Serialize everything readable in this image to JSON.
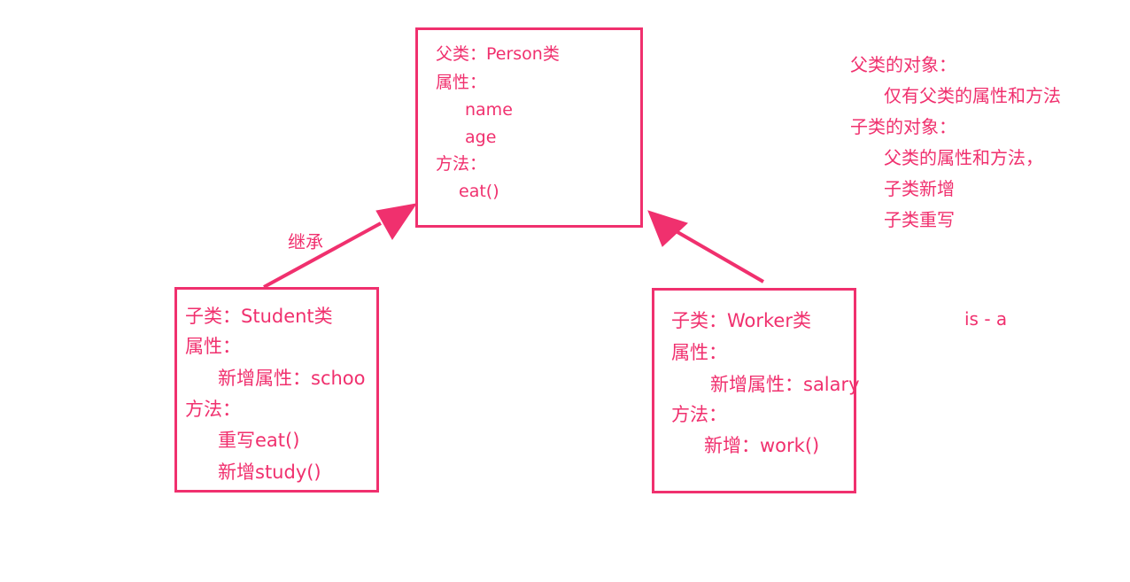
{
  "colors": {
    "accent": "#f0306e",
    "background": "#ffffff"
  },
  "parent_box": {
    "title": "父类：Person类",
    "attr_header": "属性：",
    "attrs": [
      "name",
      "age"
    ],
    "method_header": "方法：",
    "methods": [
      "eat()"
    ]
  },
  "student_box": {
    "title": "子类：Student类",
    "attr_header": "属性：",
    "attrs": [
      "新增属性：schoo"
    ],
    "method_header": "方法：",
    "methods": [
      "重写eat()",
      "新增study()"
    ]
  },
  "worker_box": {
    "title": "子类：Worker类",
    "attr_header": "属性：",
    "attrs": [
      "新增属性：salary"
    ],
    "method_header": "方法：",
    "methods": [
      "新增：work()"
    ]
  },
  "inherit_label": "继承",
  "is_a_label": "is - a",
  "notes": {
    "parent_obj_title": "父类的对象：",
    "parent_obj_items": [
      "仅有父类的属性和方法"
    ],
    "child_obj_title": "子类的对象：",
    "child_obj_items": [
      "父类的属性和方法，",
      "子类新增",
      "子类重写"
    ]
  },
  "arrows": [
    {
      "from": "student_box",
      "to": "parent_box"
    },
    {
      "from": "worker_box",
      "to": "parent_box"
    }
  ]
}
